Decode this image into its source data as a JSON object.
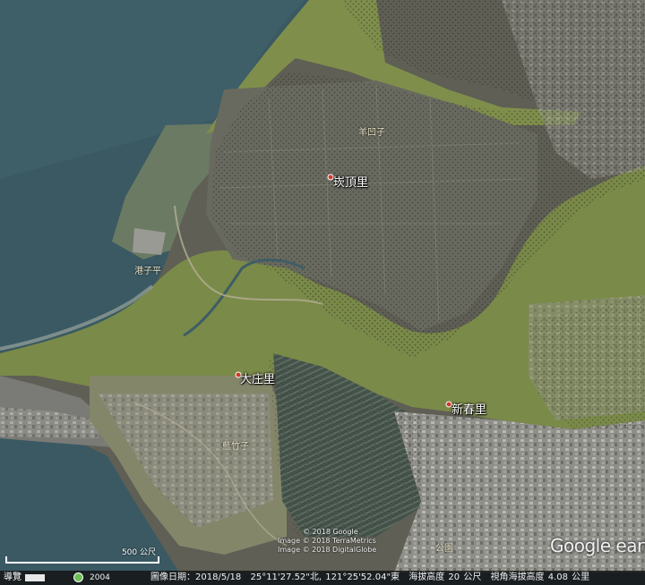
{
  "places": {
    "kengding": "崁頂里",
    "dazhuang": "大庄里",
    "xinchun": "新春里"
  },
  "labels": {
    "yangliao": "羊凹子",
    "gangzi": "港子平",
    "lanzhu": "藍竹子",
    "park": "公園"
  },
  "credits": {
    "line1": "© 2018 Google",
    "line2": "Image © 2018 TerraMetrics",
    "line3": "Image © 2018 DigitalGlobe"
  },
  "scale": {
    "label": "500 公尺"
  },
  "logo": "Google earth",
  "statusbar": {
    "tour": "導覽",
    "year": "2004",
    "date": "圖像日期：2018/5/18",
    "coords": "25°11'27.52\"北, 121°25'52.04\"東",
    "elevation": "海拔高度 20 公尺",
    "eye_alt": "視角海拔高度 4.08 公里"
  },
  "colors": {
    "water": "#3d5c66",
    "land": "#5e5e52",
    "green": "#7c8a4a",
    "urban": "#8a8a86"
  }
}
